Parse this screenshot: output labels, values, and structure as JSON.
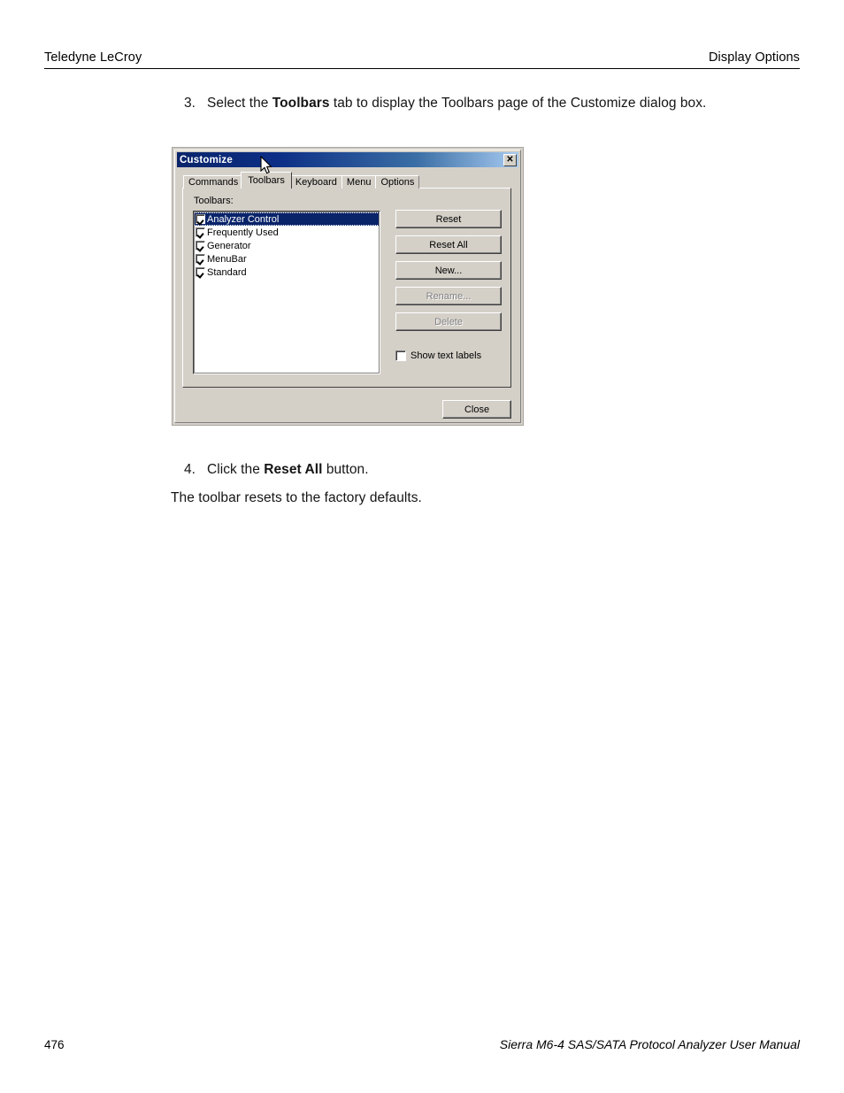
{
  "page": {
    "header": {
      "left": "Teledyne LeCroy",
      "right": "Display Options"
    },
    "footer": {
      "page_number": "476",
      "manual_title": "Sierra M6-4 SAS/SATA Protocol Analyzer User Manual"
    }
  },
  "steps": {
    "step3": {
      "number": "3.",
      "text_before": "Select the ",
      "bold": "Toolbars",
      "text_after": " tab to display the Toolbars page of the Customize dialog box."
    },
    "step4": {
      "number": "4.",
      "text_before": "Click the ",
      "bold": "Reset All",
      "text_after": " button."
    },
    "result_paragraph": "The toolbar resets to the factory defaults."
  },
  "dialog": {
    "title": "Customize",
    "close_icon": "✕",
    "tabs": [
      {
        "label": "Commands",
        "active": false
      },
      {
        "label": "Toolbars",
        "active": true
      },
      {
        "label": "Keyboard",
        "active": false
      },
      {
        "label": "Menu",
        "active": false
      },
      {
        "label": "Options",
        "active": false
      }
    ],
    "toolbars_page": {
      "list_label": "Toolbars:",
      "items": [
        {
          "label": "Analyzer Control",
          "checked": true,
          "selected": true
        },
        {
          "label": "Frequently Used",
          "checked": true,
          "selected": false
        },
        {
          "label": "Generator",
          "checked": true,
          "selected": false
        },
        {
          "label": "MenuBar",
          "checked": true,
          "selected": false
        },
        {
          "label": "Standard",
          "checked": true,
          "selected": false
        }
      ],
      "buttons": [
        {
          "label": "Reset",
          "enabled": true
        },
        {
          "label": "Reset All",
          "enabled": true
        },
        {
          "label": "New...",
          "enabled": true
        },
        {
          "label": "Rename...",
          "enabled": false
        },
        {
          "label": "Delete",
          "enabled": false
        }
      ],
      "show_text_labels": {
        "label": "Show text labels",
        "checked": false
      }
    },
    "close_button": "Close"
  },
  "colors": {
    "dialog_face": "#d4d0c8",
    "titlebar_start": "#0a246a",
    "titlebar_end": "#a6caf0",
    "selection": "#0a246a",
    "disabled_text": "#808080"
  }
}
